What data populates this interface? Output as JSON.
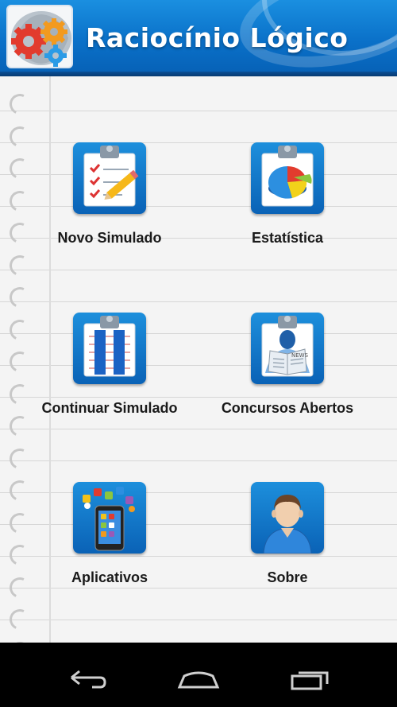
{
  "header": {
    "title": "Raciocínio Lógico",
    "logo_icon": "gears-logo-icon",
    "colors": {
      "primary": "#0a70c8",
      "light": "#1a8fe0"
    }
  },
  "menu": [
    {
      "label": "Novo Simulado",
      "icon": "checklist-clipboard-icon"
    },
    {
      "label": "Estatística",
      "icon": "pie-chart-clipboard-icon"
    },
    {
      "label": "Continuar Simulado",
      "icon": "pause-clipboard-icon"
    },
    {
      "label": "Concursos Abertos",
      "icon": "newspaper-reader-icon"
    },
    {
      "label": "Aplicativos",
      "icon": "smartphone-apps-icon"
    },
    {
      "label": "Sobre",
      "icon": "user-profile-icon"
    }
  ],
  "navbar": {
    "back": "back-icon",
    "home": "home-icon",
    "recents": "recent-apps-icon"
  }
}
